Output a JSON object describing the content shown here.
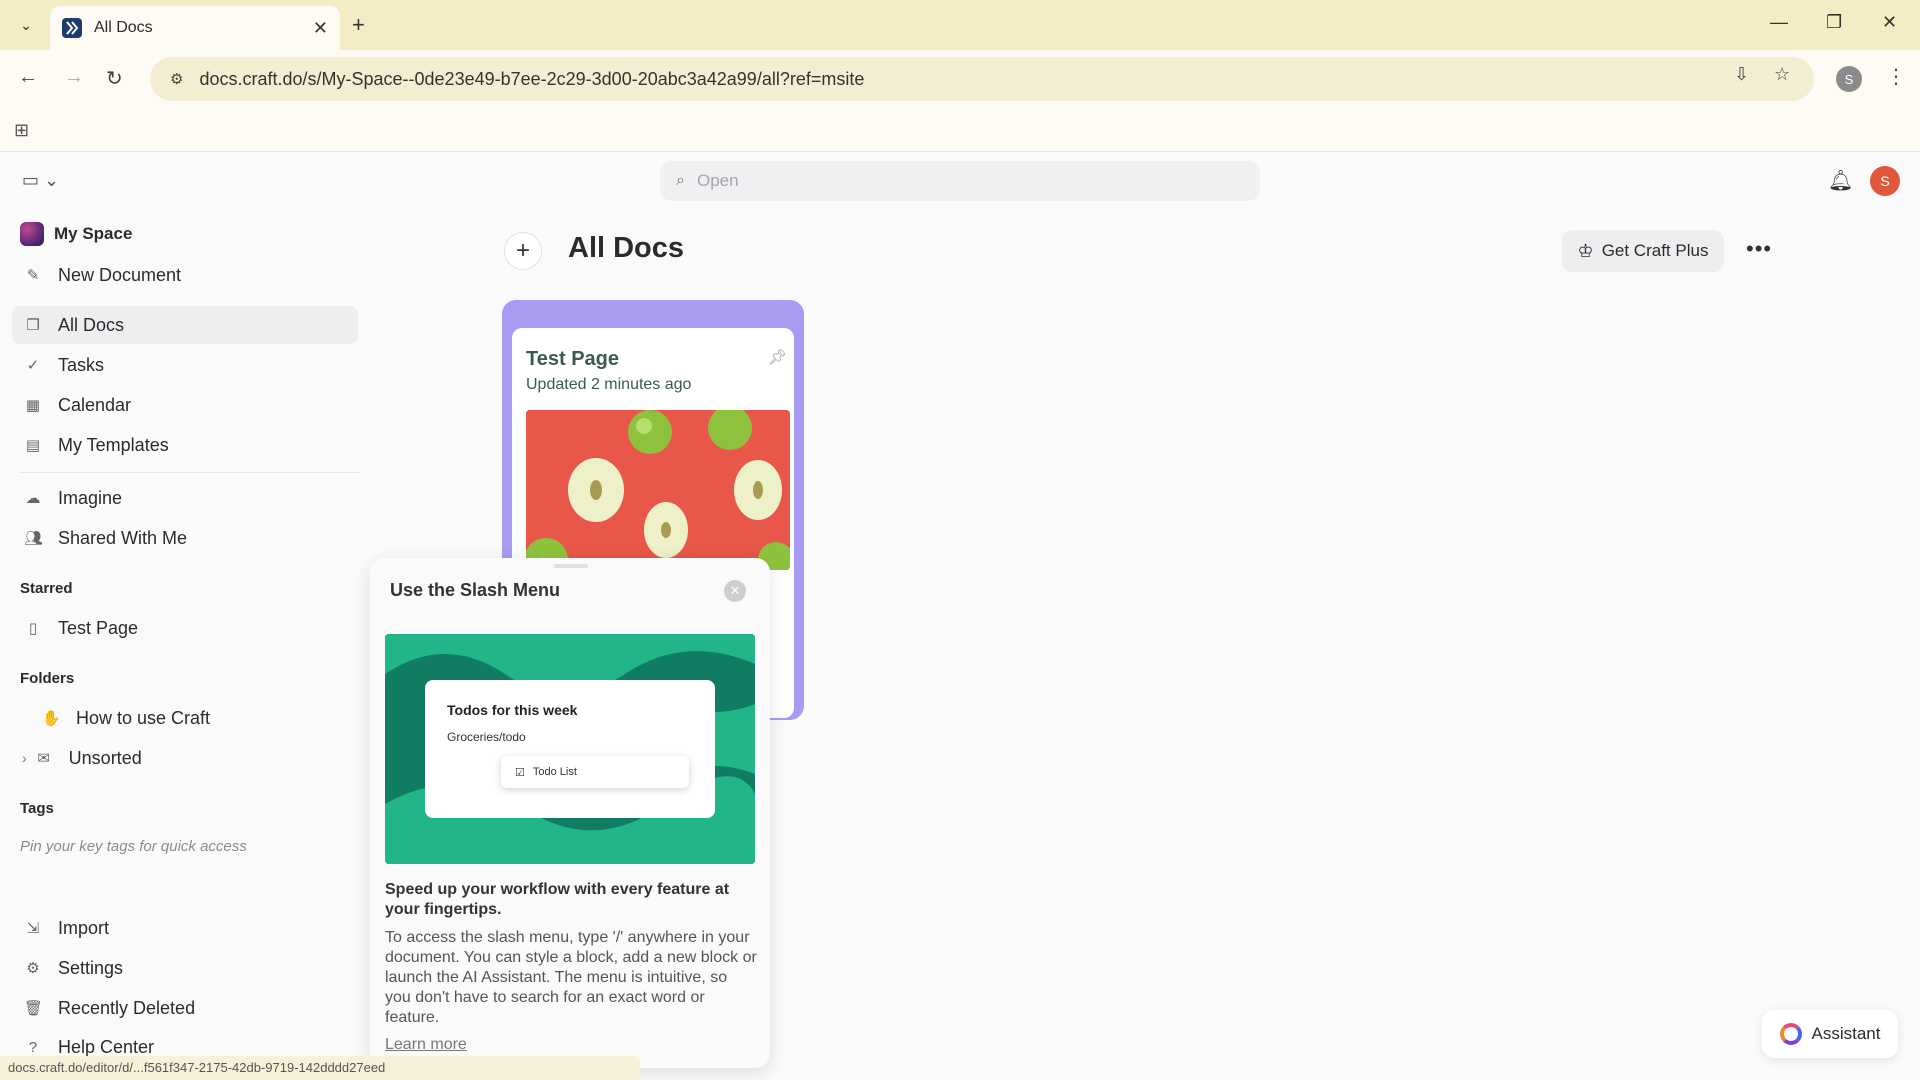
{
  "browser": {
    "tab_title": "All Docs",
    "url": "docs.craft.do/s/My-Space--0de23e49-b7ee-2c29-3d00-20abc3a42a99/all?ref=msite",
    "profile_initial": "S",
    "status_url": "docs.craft.do/editor/d/...f561f347-2175-42db-9719-142dddd27eed"
  },
  "header": {
    "search_placeholder": "Open",
    "avatar_initial": "S"
  },
  "sidebar": {
    "space_name": "My Space",
    "new_document": "New Document",
    "items": [
      {
        "label": "All Docs",
        "icon": "docs-icon"
      },
      {
        "label": "Tasks",
        "icon": "check-circle-icon"
      },
      {
        "label": "Calendar",
        "icon": "calendar-icon"
      },
      {
        "label": "My Templates",
        "icon": "template-icon"
      }
    ],
    "items2": [
      {
        "label": "Imagine",
        "icon": "cloud-icon"
      },
      {
        "label": "Shared With Me",
        "icon": "people-icon"
      }
    ],
    "starred_heading": "Starred",
    "starred_item": "Test Page",
    "folders_heading": "Folders",
    "folders": [
      {
        "label": "How to use Craft",
        "icon": "wave-hand-icon"
      },
      {
        "label": "Unsorted",
        "icon": "inbox-icon"
      }
    ],
    "tags_heading": "Tags",
    "tags_hint": "Pin your key tags for quick access",
    "bottom": [
      {
        "label": "Import",
        "icon": "import-icon"
      },
      {
        "label": "Settings",
        "icon": "settings-icon"
      },
      {
        "label": "Recently Deleted",
        "icon": "trash-icon"
      },
      {
        "label": "Help Center",
        "icon": "help-icon"
      }
    ]
  },
  "main": {
    "title": "All Docs",
    "cta": "Get Craft Plus",
    "doc": {
      "title": "Test Page",
      "updated": "Updated 2 minutes ago"
    }
  },
  "popup": {
    "title": "Use the Slash Menu",
    "illus_title": "Todos for this week",
    "illus_text": "Groceries/todo",
    "illus_menu": "Todo List",
    "lead": "Speed up your workflow with every feature at your fingertips.",
    "body": "To access the slash menu, type '/' anywhere in your document. You can style a block, add a new block or launch the AI Assistant. The menu is intuitive, so you don't have to search for an exact word or feature.",
    "link": "Learn more"
  },
  "assistant": {
    "label": "Assistant"
  },
  "colors": {
    "tabbar_bg": "#f3ecc4",
    "doc_card_accent": "#a79cf1",
    "popup_illustration": "#0f7c63",
    "avatar": "#e0573c"
  }
}
